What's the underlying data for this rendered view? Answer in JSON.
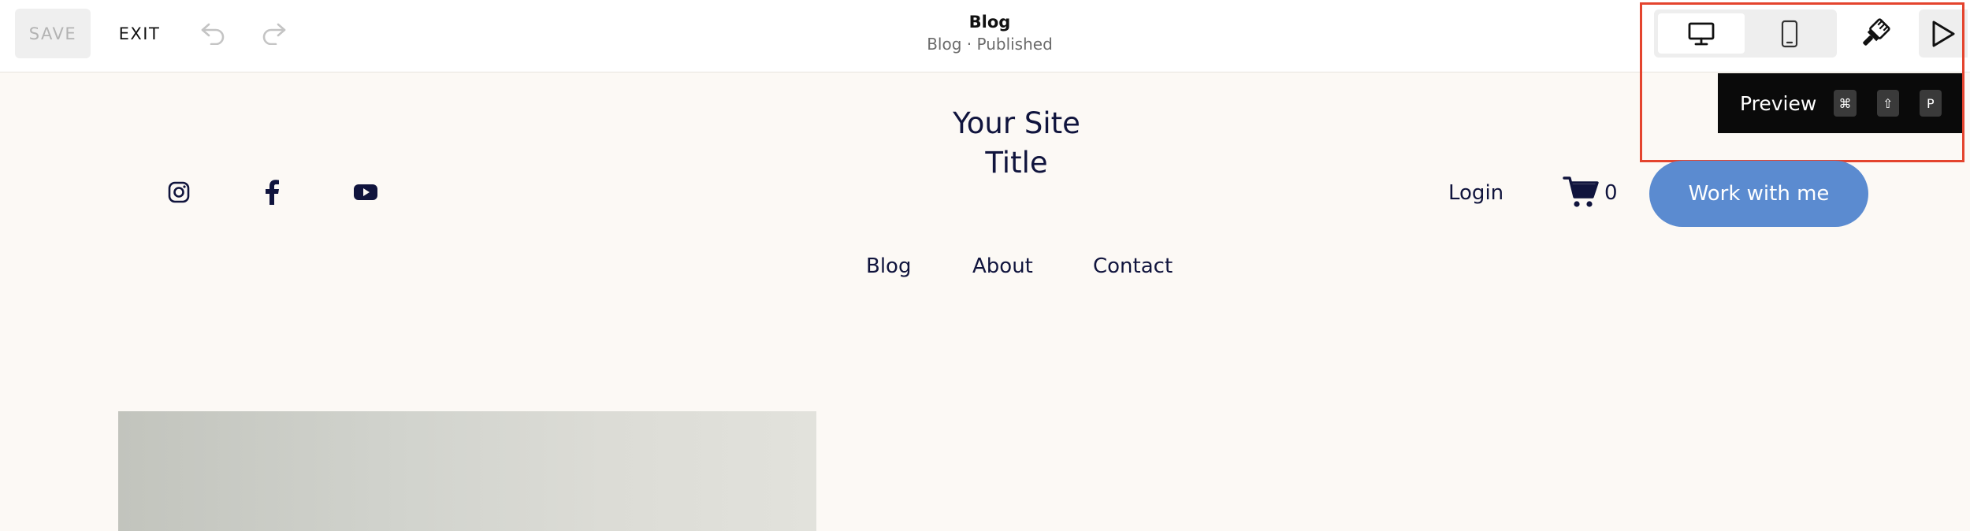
{
  "toolbar": {
    "save_label": "SAVE",
    "exit_label": "EXIT",
    "page_title": "Blog",
    "page_status": "Blog · Published",
    "tooltip": {
      "label": "Preview",
      "keys": [
        "⌘",
        "⇧",
        "P"
      ]
    }
  },
  "site": {
    "title_line1": "Your Site",
    "title_line2": "Title",
    "login_label": "Login",
    "cart_count": "0",
    "cta_label": "Work with me",
    "nav": [
      "Blog",
      "About",
      "Contact"
    ],
    "social": [
      "instagram-icon",
      "facebook-icon",
      "youtube-icon"
    ]
  },
  "colors": {
    "page_bg": "#fcf9f5",
    "text": "#10143d",
    "cta_bg": "#5b8bd0",
    "highlight": "#e4442e"
  }
}
